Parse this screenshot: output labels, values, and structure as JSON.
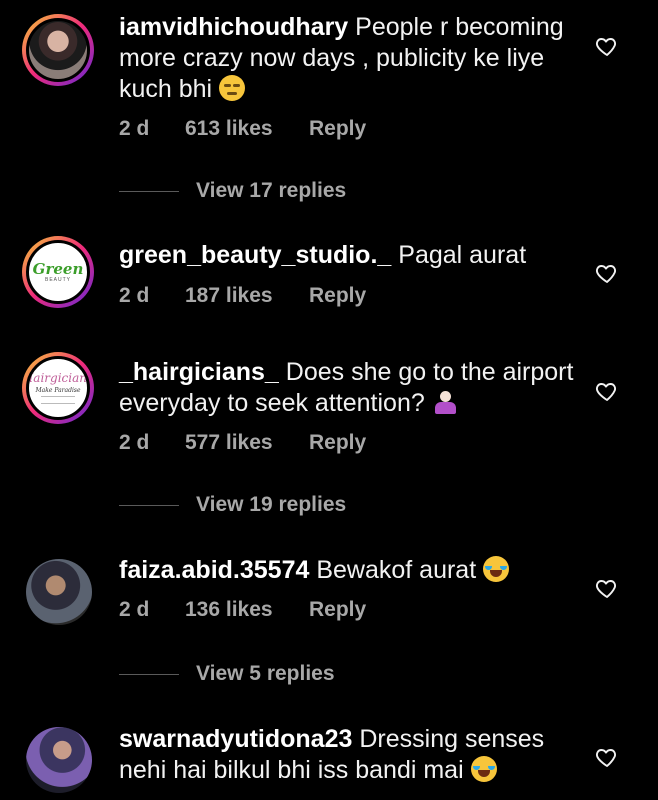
{
  "comments": [
    {
      "username": "iamvidhichoudhary",
      "text": "People r becoming more crazy now days , publicity ke liye kuch bhi",
      "emoji": "unamused-face",
      "time": "2 d",
      "likes": "613 likes",
      "reply_label": "Reply",
      "view_replies": "View 17 replies"
    },
    {
      "username": "green_beauty_studio._",
      "text": "Pagal aurat",
      "time": "2 d",
      "likes": "187 likes",
      "reply_label": "Reply",
      "avatar_logo": {
        "title": "Green",
        "sub": "BEAUTY"
      }
    },
    {
      "username": "_hairgicians_",
      "text": "Does she go to the airport everyday to seek attention?",
      "emoji": "person-shrugging",
      "time": "2 d",
      "likes": "577 likes",
      "reply_label": "Reply",
      "view_replies": "View 19 replies",
      "avatar_logo": {
        "title": "Hairgicians",
        "sub": "Make Paradise"
      }
    },
    {
      "username": "faiza.abid.35574",
      "text": "Bewakof aurat",
      "emoji": "face-with-tears-of-joy",
      "time": "2 d",
      "likes": "136 likes",
      "reply_label": "Reply",
      "view_replies": "View 5 replies"
    },
    {
      "username": "swarnadyutidona23",
      "text": "Dressing senses nehi hai bilkul bhi iss bandi mai",
      "emoji": "face-with-tears-of-joy"
    }
  ],
  "icons": {
    "like": "heart-outline-icon"
  },
  "colors": {
    "background": "#000000",
    "text": "#f2f2f2",
    "meta": "#a8a8a8",
    "story_ring": "#ee2a7b"
  }
}
